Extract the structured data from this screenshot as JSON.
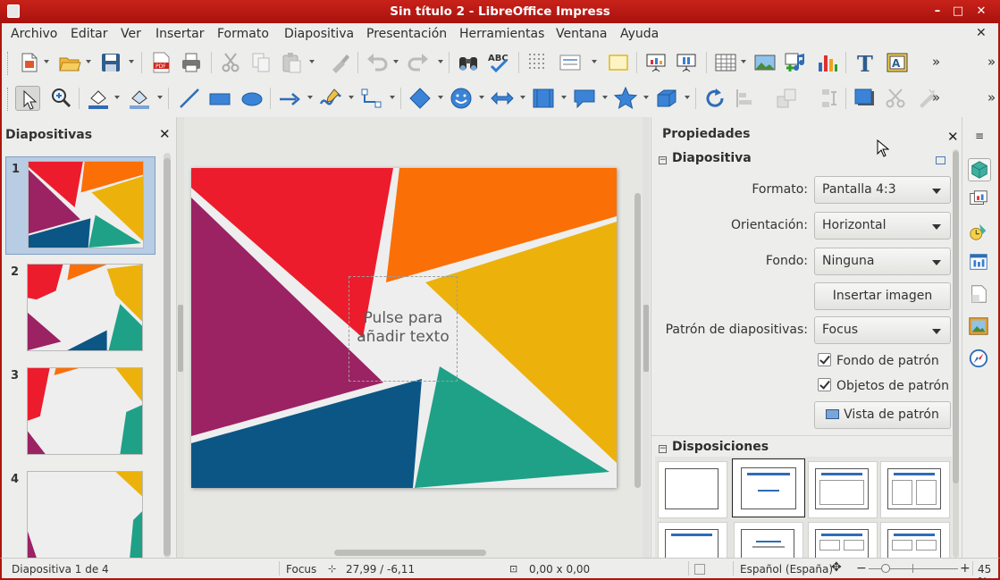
{
  "window": {
    "title": "Sin título 2 - LibreOffice Impress",
    "controls": [
      "–",
      "□",
      "✕"
    ]
  },
  "menu": [
    "Archivo",
    "Editar",
    "Ver",
    "Insertar",
    "Formato",
    "Diapositiva",
    "Presentación",
    "Herramientas",
    "Ventana",
    "Ayuda"
  ],
  "menu_close": "✕",
  "toolbar_overflow": "»",
  "slides_pane": {
    "title": "Diapositivas",
    "close": "✕",
    "slides": [
      {
        "number": "1",
        "selected": true
      },
      {
        "number": "2",
        "selected": false
      },
      {
        "number": "3",
        "selected": false
      },
      {
        "number": "4",
        "selected": false
      }
    ]
  },
  "slide": {
    "placeholder_text": "Pulse para añadir texto"
  },
  "properties": {
    "title": "Propiedades",
    "close": "✕",
    "slide_section": {
      "title": "Diapositiva",
      "format_label": "Formato:",
      "format_value": "Pantalla 4:3",
      "orientation_label": "Orientación:",
      "orientation_value": "Horizontal",
      "background_label": "Fondo:",
      "background_value": "Ninguna",
      "insert_image_button": "Insertar imagen",
      "master_label": "Patrón de diapositivas:",
      "master_value": "Focus",
      "master_background_check": "Fondo de patrón",
      "master_objects_check": "Objetos de patrón",
      "master_view_button": "Vista de patrón"
    },
    "layouts_section": {
      "title": "Disposiciones"
    }
  },
  "status": {
    "slide_counter": "Diapositiva 1 de 4",
    "master_name": "Focus",
    "position": "27,99 / -6,11",
    "size": "0,00 x 0,00",
    "language": "Español (España)",
    "zoom_minus": "−",
    "zoom_plus": "+",
    "zoom": "45 %",
    "zoom_level": 0.45
  },
  "colors": {
    "red": "#ec1c2c",
    "orange": "#fb6f07",
    "yellow": "#ecb20b",
    "teal": "#1ea187",
    "navy": "#0c5685",
    "purple": "#9b2263",
    "title_bar": "#b91a13"
  }
}
